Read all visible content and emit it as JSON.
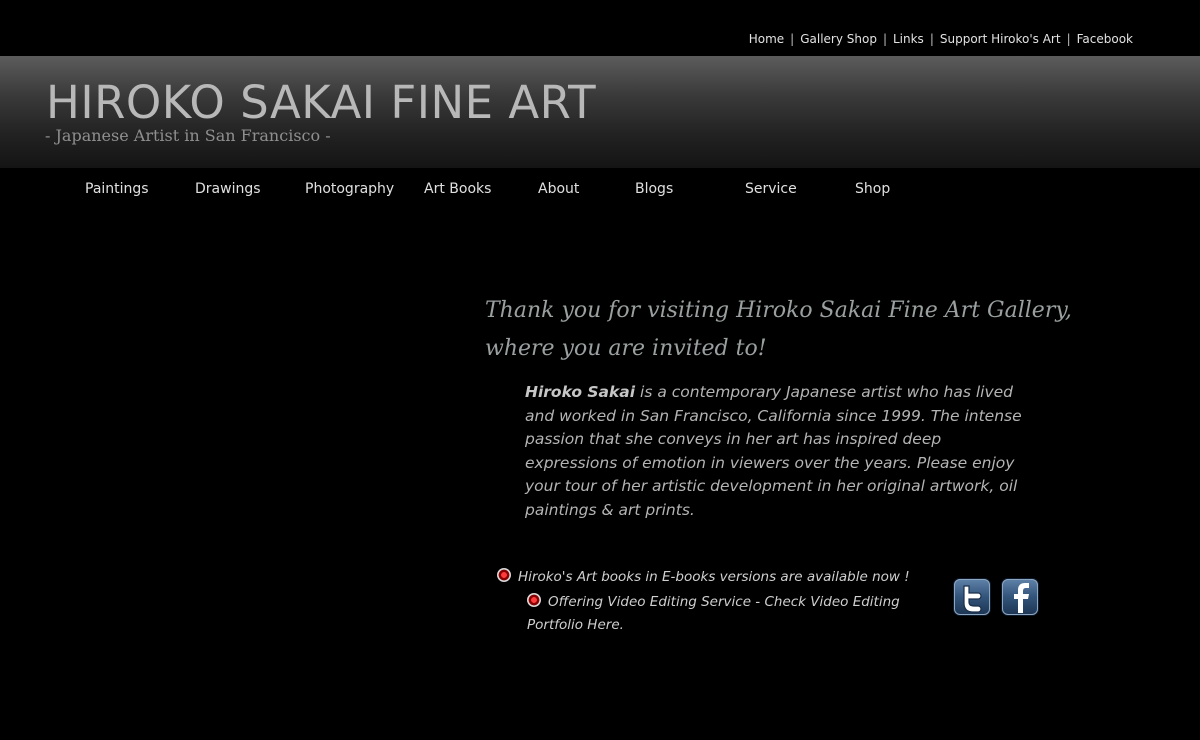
{
  "top_nav": {
    "items": [
      "Home",
      "Gallery Shop",
      "Links",
      "Support Hiroko's Art",
      "Facebook"
    ],
    "separator": "|"
  },
  "header": {
    "title": "HIROKO SAKAI FINE ART",
    "tagline": "- Japanese Artist in San Francisco -"
  },
  "main_nav": {
    "items": [
      "Paintings",
      "Drawings",
      "Photography",
      "Art Books",
      "About",
      "Blogs",
      "Service",
      "Shop"
    ]
  },
  "content": {
    "welcome_line1": "Thank you for visiting Hiroko Sakai Fine Art Gallery,",
    "welcome_line2": "where you are invited to!",
    "intro_name": "Hiroko Sakai",
    "intro_text": " is a contemporary Japanese artist who has lived and worked in San Francisco, California since 1999. The intense passion that she conveys in her art has inspired deep expressions of emotion in viewers over the years. Please enjoy your tour of her artistic development in her original artwork, oil paintings & art prints."
  },
  "news": [
    {
      "text": "Hiroko's Art books in E-books versions are available now !"
    },
    {
      "text": "Offering Video Editing Service - Check Video Editing Portfolio Here."
    }
  ],
  "social": [
    {
      "icon": "twitter-icon"
    },
    {
      "icon": "facebook-icon"
    }
  ],
  "colors": {
    "background": "#000000",
    "header_gradient_top": "#5c5c5c",
    "title_text": "#b8b8b8",
    "welcome_text": "#9aa0a0",
    "bullet_red": "#cc0000",
    "social_blue": "#33547a"
  }
}
